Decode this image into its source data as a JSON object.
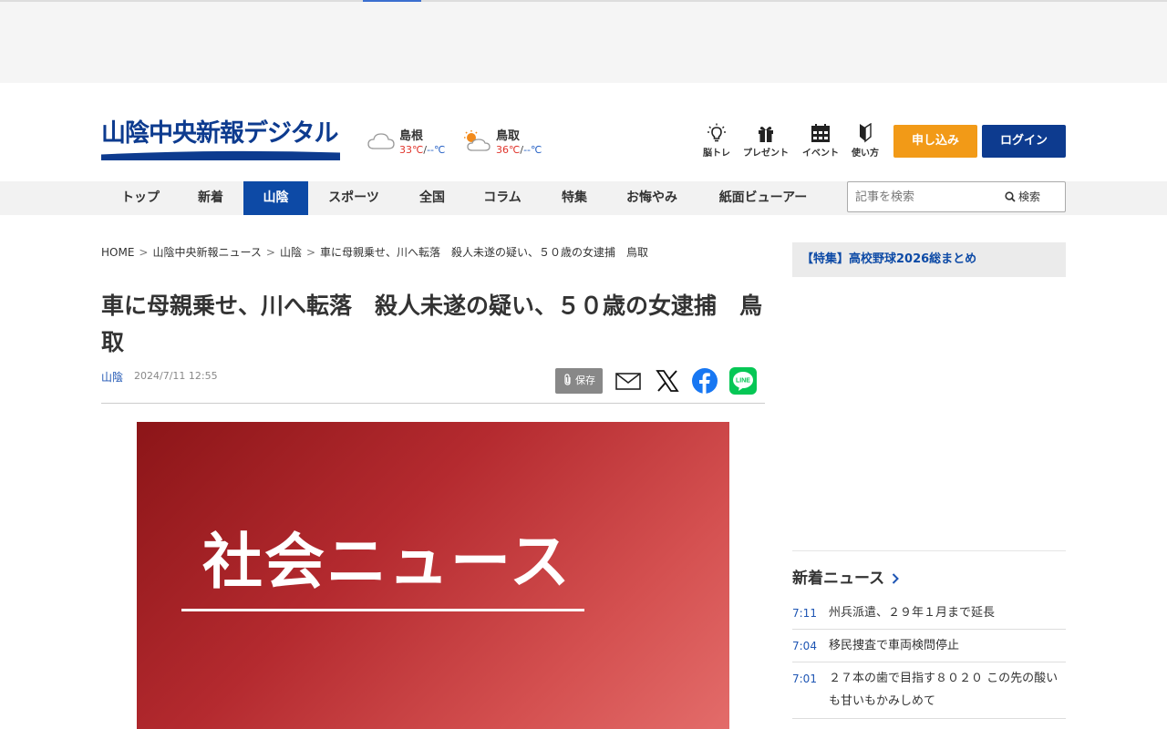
{
  "header": {
    "logo_text": "山陰中央新報デジタル",
    "weather": [
      {
        "city": "島根",
        "high": "33℃",
        "sep": "/",
        "low": "--℃",
        "icon": "cloud-icon"
      },
      {
        "city": "鳥取",
        "high": "36℃",
        "sep": "/",
        "low": "--℃",
        "icon": "sun-cloud-icon"
      }
    ],
    "tools": [
      {
        "label": "脳トレ",
        "icon": "lightbulb-icon"
      },
      {
        "label": "プレゼント",
        "icon": "gift-icon"
      },
      {
        "label": "イベント",
        "icon": "calendar-icon"
      },
      {
        "label": "使い方",
        "icon": "beginner-mark-icon"
      }
    ],
    "apply_label": "申し込み",
    "login_label": "ログイン"
  },
  "nav": {
    "items": [
      "トップ",
      "新着",
      "山陰",
      "スポーツ",
      "全国",
      "コラム",
      "特集",
      "お悔やみ",
      "紙面ビューアー"
    ],
    "active": "山陰",
    "search_placeholder": "記事を検索",
    "search_button": "検索"
  },
  "breadcrumb": [
    "HOME",
    "山陰中央新報ニュース",
    "山陰",
    "車に母親乗せ、川へ転落　殺人未遂の疑い、５０歳の女逮捕　鳥取"
  ],
  "breadcrumb_sep": ">",
  "article": {
    "title": "車に母親乗せ、川へ転落　殺人未遂の疑い、５０歳の女逮捕　鳥取",
    "category": "山陰",
    "date": "2024/7/11 12:55",
    "save_label": "保存",
    "share": [
      "mail-icon",
      "x-icon",
      "facebook-icon",
      "line-icon"
    ],
    "share_line_text": "LINE",
    "hero_text": "社会ニュース"
  },
  "sidebar": {
    "feature": "【特集】高校野球2026総まとめ",
    "news_heading": "新着ニュース",
    "news": [
      {
        "time": "7:11",
        "text": "州兵派遣、２９年１月まで延長"
      },
      {
        "time": "7:04",
        "text": "移民捜査で車両検問停止"
      },
      {
        "time": "7:01",
        "text": "２７本の歯で目指す８０２０ この先の酸いも甘いもかみしめて"
      }
    ]
  },
  "colors": {
    "brand": "#0d3b8f",
    "nav_active": "#0d4aa6",
    "apply": "#f29a17",
    "temp_high": "#e0342b",
    "temp_low": "#2a64c6",
    "facebook": "#1877f2",
    "line": "#06c755"
  }
}
